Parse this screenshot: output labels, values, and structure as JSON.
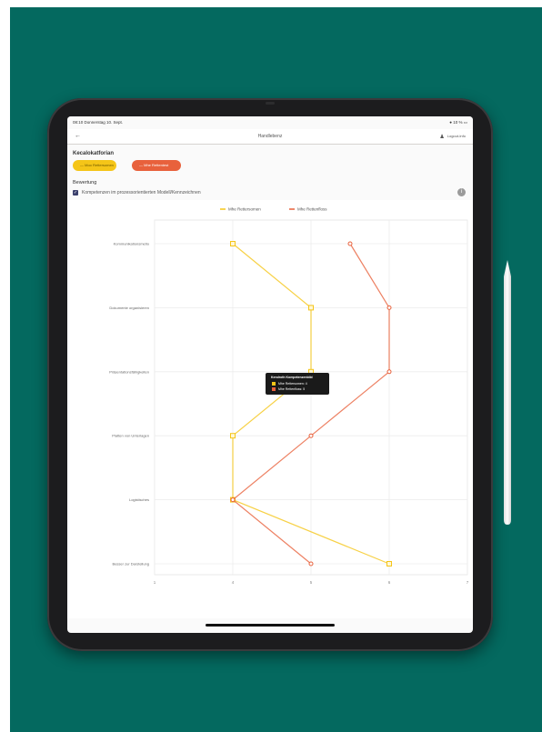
{
  "statusbar": {
    "time": "08:10  Donnerstag 10. Sept.",
    "right": "● 10 % ▭"
  },
  "navbar": {
    "back_icon": "arrow-left-icon",
    "title": "Handlebenz",
    "user_label": "Logout-Info"
  },
  "filter": {
    "title": "Kecalokatforian",
    "chips": [
      {
        "label": "—  Moo Rettersomen",
        "color": "#f5c518"
      },
      {
        "label": "—  Mhe Rettentest",
        "color": "#e8613c"
      }
    ]
  },
  "bewertung": {
    "title": "Bewertung",
    "checkbox_label": "Kompetenzen im prozessorientierten Modell/Kennzeichnen",
    "checked": true
  },
  "tooltip": {
    "title": "Kendroth Kompetenzenbild",
    "rows": [
      "Mhe Rettersomen: 4",
      "Mhe Rettenfloss: 5"
    ]
  },
  "chart_data": {
    "type": "line",
    "legend_position": "top",
    "categories": [
      "Kommunikationsmetio",
      "Dokumente organisieren",
      "Präsentationsfähigkeiten",
      "Platten von Unterlagen",
      "Logistisches",
      "Besser zur Darstellung"
    ],
    "x_ticks": [
      "1",
      "4",
      "5",
      "6",
      "7"
    ],
    "xlim": [
      3,
      7
    ],
    "series": [
      {
        "name": "Mhe Rettersomen",
        "color": "#f5c518",
        "values": [
          4,
          5,
          5,
          4,
          4,
          6
        ]
      },
      {
        "name": "Mhe Rettenfloss",
        "color": "#e8613c",
        "values": [
          5.5,
          6,
          6,
          5,
          4,
          5
        ]
      }
    ],
    "grid": true
  }
}
